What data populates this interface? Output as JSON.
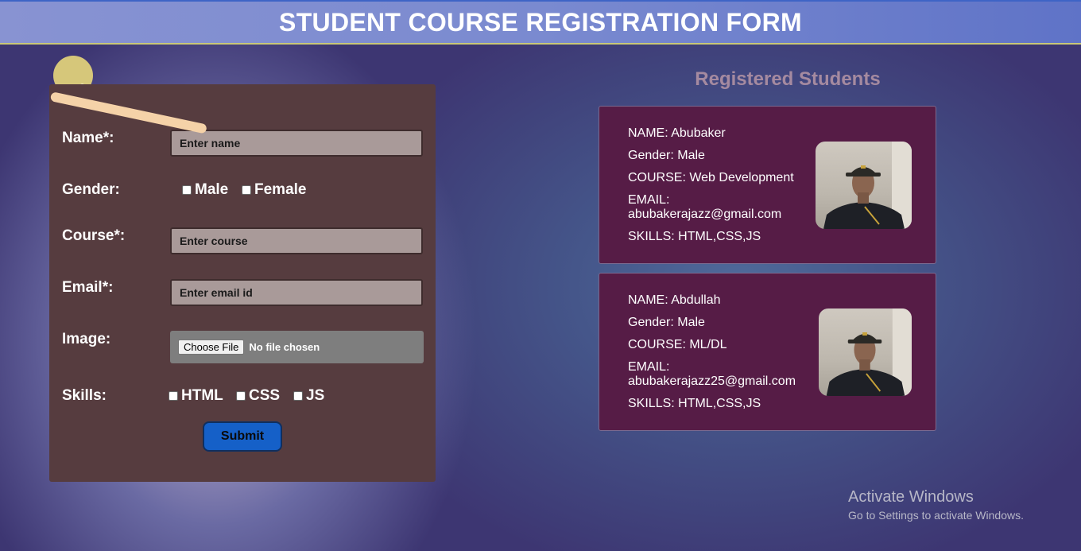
{
  "header": {
    "title": "STUDENT COURSE REGISTRATION FORM"
  },
  "form": {
    "name_label": "Name*:",
    "name_placeholder": "Enter name",
    "gender_label": "Gender:",
    "gender_options": [
      "Male",
      "Female"
    ],
    "course_label": "Course*:",
    "course_placeholder": "Enter course",
    "email_label": "Email*:",
    "email_placeholder": "Enter email id",
    "image_label": "Image:",
    "file_button": "Choose File",
    "file_status": "No file chosen",
    "skills_label": "Skills:",
    "skill_options": [
      "HTML",
      "CSS",
      "JS"
    ],
    "submit_label": "Submit"
  },
  "registered": {
    "title": "Registered Students",
    "students": [
      {
        "name": "NAME: Abubaker",
        "gender": "Gender: Male",
        "course": "COURSE: Web Development",
        "email_label": "EMAIL:",
        "email": "abubakerajazz@gmail.com",
        "skills": "SKILLS: HTML,CSS,JS"
      },
      {
        "name": "NAME: Abdullah",
        "gender": "Gender: Male",
        "course": "COURSE: ML/DL",
        "email_label": "EMAIL:",
        "email": "abubakerajazz25@gmail.com",
        "skills": "SKILLS: HTML,CSS,JS"
      }
    ]
  },
  "watermark": {
    "title": "Activate Windows",
    "subtitle": "Go to Settings to activate Windows."
  }
}
